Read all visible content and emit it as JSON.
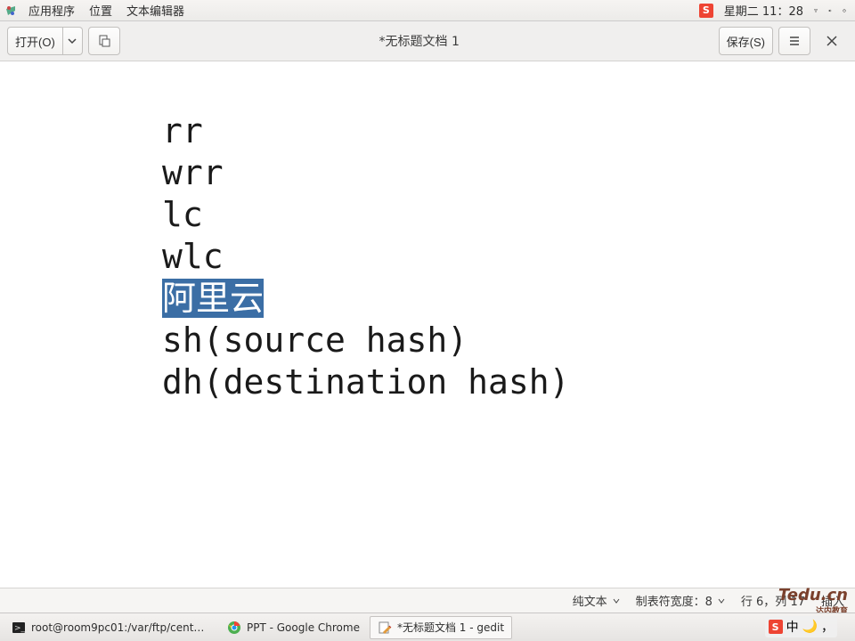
{
  "top_panel": {
    "menu_apps": "应用程序",
    "menu_places": "位置",
    "menu_texteditor": "文本编辑器",
    "clock": "星期二 11：28"
  },
  "toolbar": {
    "open_label": "打开(O)",
    "save_label": "保存(S)",
    "title": "*无标题文档 1"
  },
  "document": {
    "line1": "rr",
    "line2": "wrr",
    "line3": "lc",
    "line4": "wlc",
    "line5_selected": "阿里云",
    "line6": "sh(source hash)",
    "line7": "dh(destination hash)"
  },
  "statusbar": {
    "syntax": "纯文本",
    "tabwidth_label": "制表符宽度：8",
    "cursor": "行 6，列 17",
    "insert_mode": "插入"
  },
  "taskbar": {
    "t1": "root@room9pc01:/var/ftp/centos-…",
    "t2": "PPT - Google Chrome",
    "t3": "*无标题文档 1 - gedit"
  },
  "ime": {
    "s": "S",
    "zhong": "中",
    "moon": "🌙",
    "comma": "，"
  },
  "watermark": {
    "brand": "Tedu.cn",
    "sub": "达内教育"
  }
}
